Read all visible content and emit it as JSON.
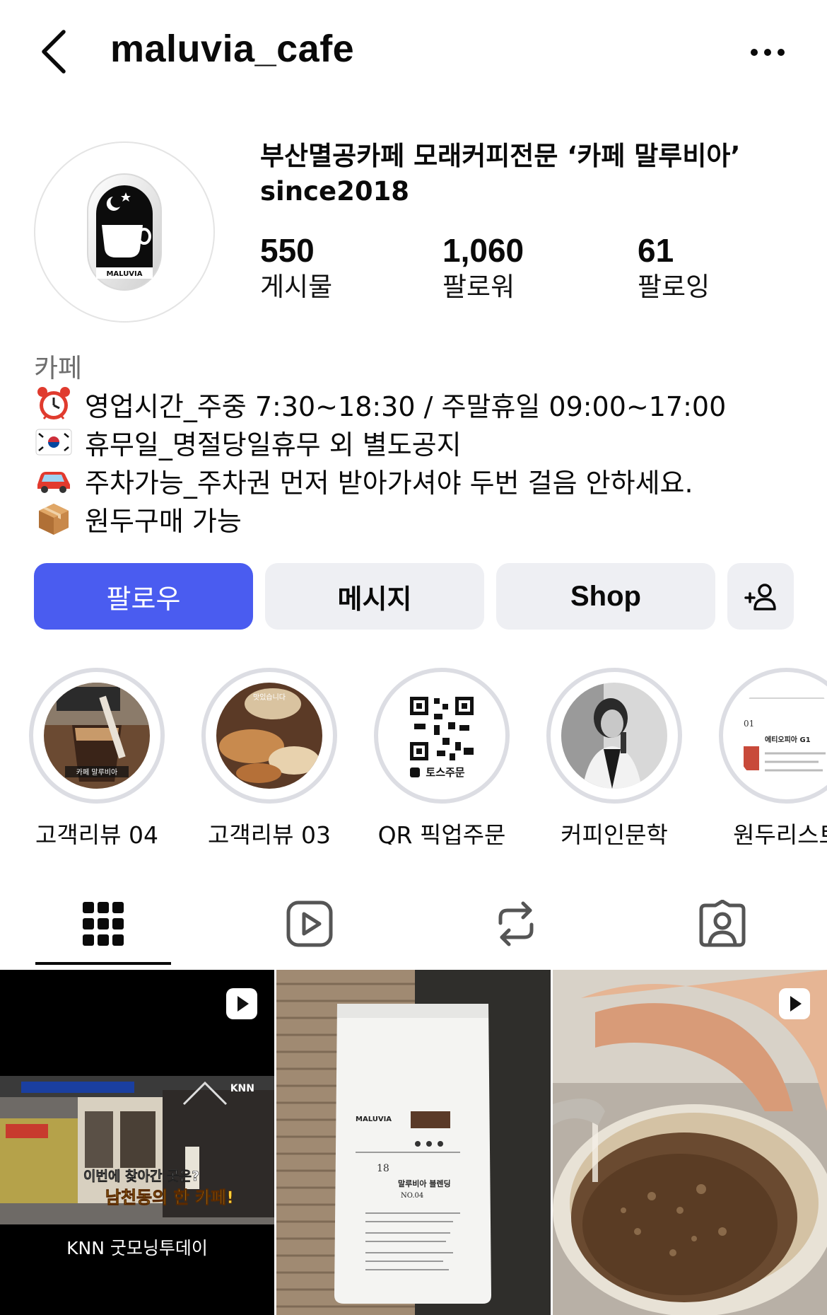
{
  "header": {
    "username": "maluvia_cafe",
    "back_icon": "chevron-left-icon",
    "more_icon": "more-horizontal-icon"
  },
  "profile": {
    "name_line1": "부산멸공카페 모래커피전문 ‘카페 말루비아’",
    "name_line2": "since2018",
    "avatar_text": "MALUVIA",
    "stats": [
      {
        "value": "550",
        "label": "게시물"
      },
      {
        "value": "1,060",
        "label": "팔로워"
      },
      {
        "value": "61",
        "label": "팔로잉"
      }
    ],
    "category": "카페",
    "bio": [
      {
        "icon": "alarm-clock-icon",
        "text": "영업시간_주중 7:30~18:30 / 주말휴일 09:00~17:00"
      },
      {
        "icon": "korea-flag-icon",
        "text": "휴무일_명절당일휴무 외 별도공지"
      },
      {
        "icon": "car-icon",
        "text": "주차가능_주차권 먼저 받아가셔야 두번 걸음 안하세요."
      },
      {
        "icon": "package-icon",
        "text": "원두구매 가능"
      }
    ]
  },
  "actions": {
    "follow": "팔로우",
    "message": "메시지",
    "shop": "Shop",
    "add_person_icon": "add-person-icon"
  },
  "highlights": [
    {
      "label": "고객리뷰 04",
      "thumb_text": "카페 말루비아"
    },
    {
      "label": "고객리뷰 03",
      "thumb_text": "맛있습니다"
    },
    {
      "label": "QR 픽업주문",
      "thumb_text": "토스주문"
    },
    {
      "label": "커피인문학",
      "thumb_text": ""
    },
    {
      "label": "원두리스트",
      "thumb_text": "에티오피아 G1"
    }
  ],
  "tabs": [
    {
      "name": "grid",
      "icon": "grid-icon"
    },
    {
      "name": "reels",
      "icon": "reels-icon"
    },
    {
      "name": "reposts",
      "icon": "repost-icon"
    },
    {
      "name": "tagged",
      "icon": "tagged-icon"
    }
  ],
  "posts": [
    {
      "caption": "KNN 굿모닝투데이",
      "overlay_1": "이번에 찾아간 곳은?",
      "overlay_2": "남천동의 한 카페!",
      "channel": "KNN",
      "type": "reel"
    },
    {
      "brand": "MALUVIA",
      "number": "18",
      "product": "말루비아 블렌딩",
      "product_no": "NO.04",
      "type": "image"
    },
    {
      "type": "reel"
    }
  ],
  "colors": {
    "follow_button": "#4a5cf0",
    "secondary_button": "#eeeff3",
    "ring": "#dcdde3"
  }
}
